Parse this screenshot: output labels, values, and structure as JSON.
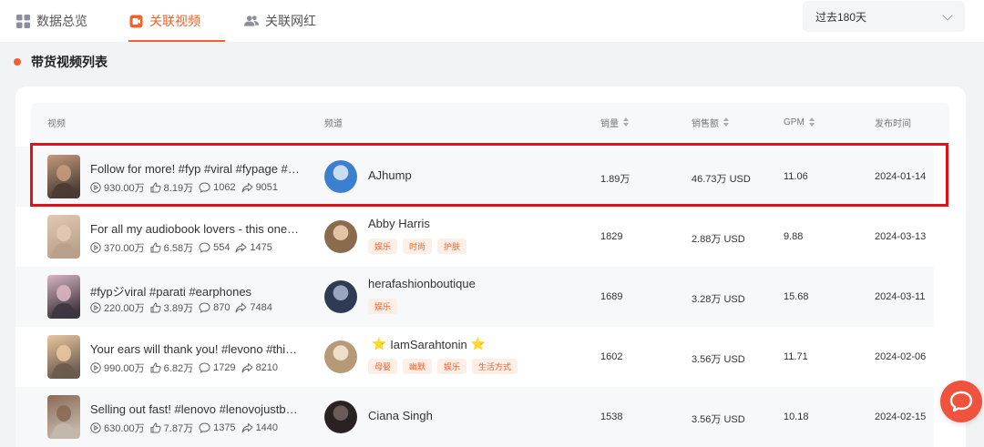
{
  "tabs": [
    {
      "label": "数据总览",
      "icon": "grid-icon",
      "active": false
    },
    {
      "label": "关联视频",
      "icon": "video-icon",
      "active": true
    },
    {
      "label": "关联网红",
      "icon": "users-icon",
      "active": false
    }
  ],
  "period": {
    "selected": "过去180天"
  },
  "section": {
    "title": "带货视频列表"
  },
  "table": {
    "headers": {
      "video": "视频",
      "channel": "频道",
      "sales": "销量",
      "revenue": "销售额",
      "gpm": "GPM",
      "date": "发布时间"
    },
    "rows": [
      {
        "title": "Follow for more! #fyp #viral #fypage #…",
        "views": "930.00万",
        "likes": "8.19万",
        "comments": "1062",
        "shares": "9051",
        "channel": "AJhump",
        "tags": [],
        "sales": "1.89万",
        "revenue": "46.73万 USD",
        "gpm": "11.06",
        "date": "2024-01-14"
      },
      {
        "title": "For all my audiobook lovers - this ones…",
        "views": "370.00万",
        "likes": "6.58万",
        "comments": "554",
        "shares": "1475",
        "channel": "Abby Harris",
        "tags": [
          "娱乐",
          "时尚",
          "护肤"
        ],
        "sales": "1829",
        "revenue": "2.88万 USD",
        "gpm": "9.88",
        "date": "2024-03-13"
      },
      {
        "title": "#fypジviral #parati #earphones",
        "views": "220.00万",
        "likes": "3.89万",
        "comments": "870",
        "shares": "7484",
        "channel": "herafashionboutique",
        "tags": [
          "娱乐"
        ],
        "sales": "1689",
        "revenue": "3.28万 USD",
        "gpm": "15.68",
        "date": "2024-03-11"
      },
      {
        "title": "Your ears will thank you! #levono #thi…",
        "views": "990.00万",
        "likes": "6.82万",
        "comments": "1729",
        "shares": "8210",
        "channel": "IamSarahtonin",
        "tags": [
          "母婴",
          "幽默",
          "娱乐",
          "生活方式"
        ],
        "sales": "1602",
        "revenue": "3.56万 USD",
        "gpm": "11.71",
        "date": "2024-02-06"
      },
      {
        "title": "Selling out fast! #lenovo #lenovojustb…",
        "views": "630.00万",
        "likes": "7.87万",
        "comments": "1375",
        "shares": "1440",
        "channel": "Ciana Singh",
        "tags": [],
        "sales": "1538",
        "revenue": "3.56万 USD",
        "gpm": "10.18",
        "date": "2024-02-15"
      }
    ]
  },
  "colors": {
    "accent": "#f0622d",
    "highlight": "#e3101a",
    "chat": "#f0533d"
  }
}
